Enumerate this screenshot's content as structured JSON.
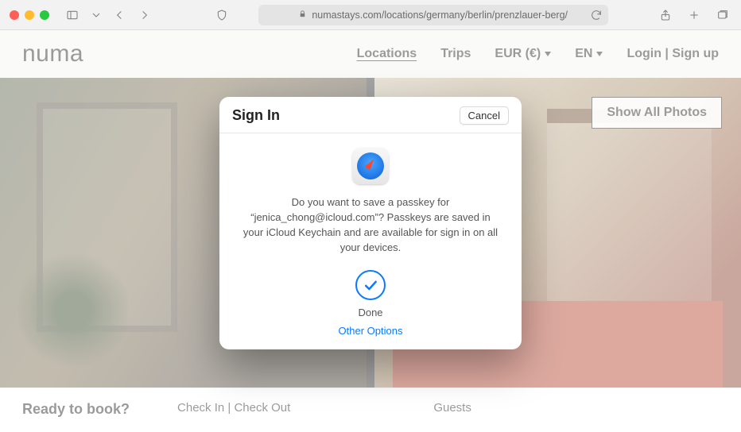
{
  "browser": {
    "url_display": "numastays.com/locations/germany/berlin/prenzlauer-berg/"
  },
  "nav": {
    "logo": "numa",
    "locations": "Locations",
    "trips": "Trips",
    "currency": "EUR (€)",
    "language": "EN",
    "auth": "Login | Sign up"
  },
  "hero": {
    "show_all": "Show All Photos"
  },
  "booking": {
    "ready": "Ready to book?",
    "check": "Check In | Check Out",
    "guests": "Guests"
  },
  "dialog": {
    "title": "Sign In",
    "cancel": "Cancel",
    "message": "Do you want to save a passkey for “jenica_chong@icloud.com”? Passkeys are saved in your iCloud Keychain and are available for sign in on all your devices.",
    "done": "Done",
    "other": "Other Options"
  }
}
